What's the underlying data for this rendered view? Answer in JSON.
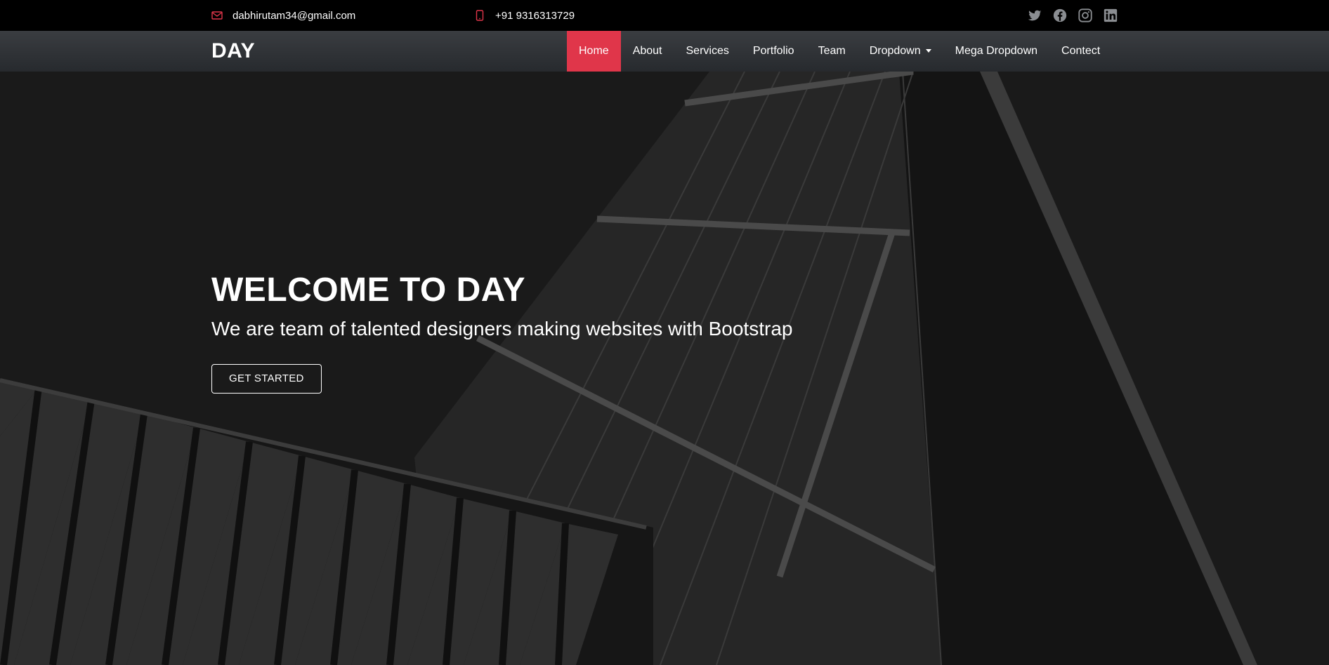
{
  "topbar": {
    "email": "dabhirutam34@gmail.com",
    "phone": "+91 9316313729",
    "email_icon": "envelope-icon",
    "phone_icon": "phone-icon",
    "socials": [
      "twitter-icon",
      "facebook-icon",
      "instagram-icon",
      "linkedin-icon"
    ]
  },
  "navbar": {
    "logo": "DAY",
    "items": [
      {
        "label": "Home"
      },
      {
        "label": "About"
      },
      {
        "label": "Services"
      },
      {
        "label": "Portfolio"
      },
      {
        "label": "Team"
      },
      {
        "label": "Dropdown"
      },
      {
        "label": "Mega Dropdown"
      },
      {
        "label": "Contect"
      }
    ],
    "active_index": 0
  },
  "hero": {
    "title": "WELCOME TO DAY",
    "subtitle": "We are team of talented designers making websites with Bootstrap",
    "cta_label": "GET STARTED"
  },
  "colors": {
    "accent": "#e0364a",
    "topbar_bg": "#000000",
    "navbar_bg": "#2f3236",
    "hero_bg": "#1b1b1b"
  }
}
